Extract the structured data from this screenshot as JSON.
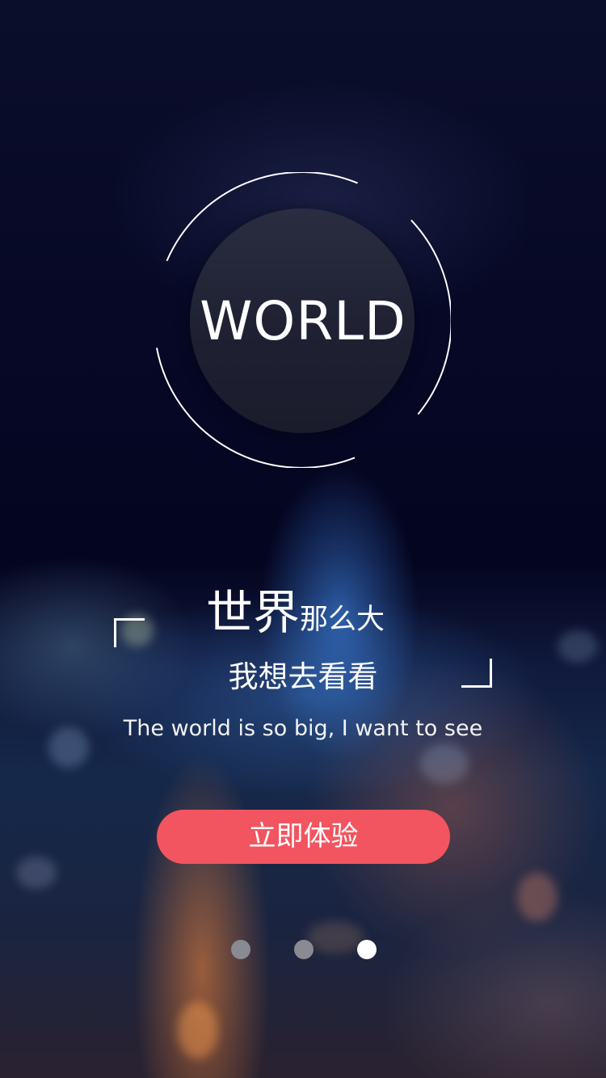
{
  "logo": {
    "text": "WORLD"
  },
  "slogan": {
    "line1_highlight": "世界",
    "line1_rest": "那么大",
    "line2": "我想去看看",
    "english": "The world is so big, I want to see"
  },
  "cta": {
    "label": "立即体验",
    "color": "#f2555f"
  },
  "pagination": {
    "total": 3,
    "active_index": 2
  }
}
